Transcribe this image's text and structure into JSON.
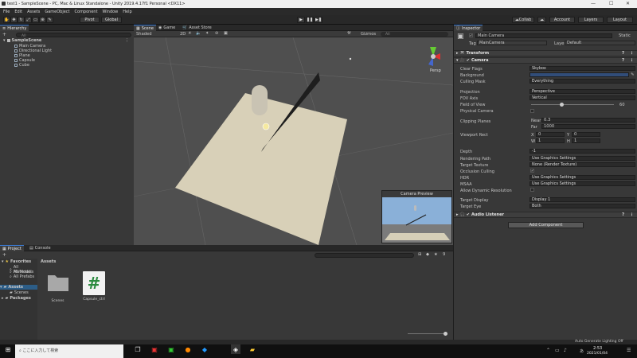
{
  "window": {
    "title": "test1 - SampleScene - PC, Mac & Linux Standalone - Unity 2019.4.17f1 Personal <DX11>",
    "minimize": "—",
    "maximize": "☐",
    "close": "✕"
  },
  "menu": [
    "File",
    "Edit",
    "Assets",
    "GameObject",
    "Component",
    "Window",
    "Help"
  ],
  "toolbar": {
    "pivot": "Pivot",
    "global": "Global",
    "collab": "Collab",
    "account": "Account",
    "layers": "Layers",
    "layout": "Layout"
  },
  "hierarchy": {
    "tab": "Hierarchy",
    "add": "+",
    "search_placeholder": "All",
    "scene": "SampleScene",
    "items": [
      "Main Camera",
      "Directional Light",
      "Plane",
      "Capsule",
      "Cube"
    ]
  },
  "scene_view": {
    "tabs": [
      "Scene",
      "Game",
      "Asset Store"
    ],
    "shading": "Shaded",
    "mode": "2D",
    "gizmos": "Gizmos",
    "search_placeholder": "All",
    "persp": "Persp",
    "preview_title": "Camera Preview"
  },
  "project": {
    "tabs": [
      "Project",
      "Console"
    ],
    "add": "+",
    "favorites_label": "Favorites",
    "favorites": [
      "All Materials",
      "All Models",
      "All Prefabs"
    ],
    "assets_label": "Assets",
    "assets_children": [
      "Scenes"
    ],
    "packages_label": "Packages",
    "breadcrumb": "Assets",
    "items": [
      {
        "name": "Scenes",
        "kind": "folder"
      },
      {
        "name": "Capsule_ctrl",
        "kind": "script"
      }
    ],
    "script_glyph": "#",
    "badge": "9"
  },
  "inspector": {
    "tab": "Inspector",
    "object_name": "Main Camera",
    "static_label": "Static",
    "tag_label": "Tag",
    "tag_value": "MainCamera",
    "layer_label": "Layer",
    "layer_value": "Default",
    "transform_title": "Transform",
    "camera_title": "Camera",
    "fields": [
      {
        "label": "Clear Flags",
        "value": "Skybox"
      },
      {
        "label": "Background",
        "value": ""
      },
      {
        "label": "Culling Mask",
        "value": "Everything"
      },
      {
        "label": "Projection",
        "value": "Perspective"
      },
      {
        "label": "FOV Axis",
        "value": "Vertical"
      },
      {
        "label": "Field of View",
        "value": "60"
      },
      {
        "label": "Physical Camera",
        "value": ""
      },
      {
        "label": "Clipping Planes",
        "value": ""
      },
      {
        "label": "Viewport Rect",
        "value": ""
      },
      {
        "label": "Depth",
        "value": "-1"
      },
      {
        "label": "Rendering Path",
        "value": "Use Graphics Settings"
      },
      {
        "label": "Target Texture",
        "value": "None (Render Texture)"
      },
      {
        "label": "Occlusion Culling",
        "value": "✔"
      },
      {
        "label": "HDR",
        "value": "Use Graphics Settings"
      },
      {
        "label": "MSAA",
        "value": "Use Graphics Settings"
      },
      {
        "label": "Allow Dynamic Resolution",
        "value": ""
      },
      {
        "label": "Target Display",
        "value": "Display 1"
      },
      {
        "label": "Target Eye",
        "value": "Both"
      }
    ],
    "clip_near_label": "Near",
    "clip_near": "0.3",
    "clip_far_label": "Far",
    "clip_far": "1000",
    "vp_x_label": "X",
    "vp_x": "0",
    "vp_y_label": "Y",
    "vp_y": "0",
    "vp_w_label": "W",
    "vp_w": "1",
    "vp_h_label": "H",
    "vp_h": "1",
    "audio_title": "Audio Listener",
    "add_component": "Add Component",
    "status": "Auto Generate Lighting Off"
  },
  "taskbar": {
    "search_placeholder": "ここに入力して検索",
    "time": "2:53",
    "date": "2021/01/04",
    "ime": "あ"
  },
  "colors": {
    "accent": "#3a7bd5",
    "camera_bg": "#314d79",
    "plane": "#d8d0b8"
  }
}
